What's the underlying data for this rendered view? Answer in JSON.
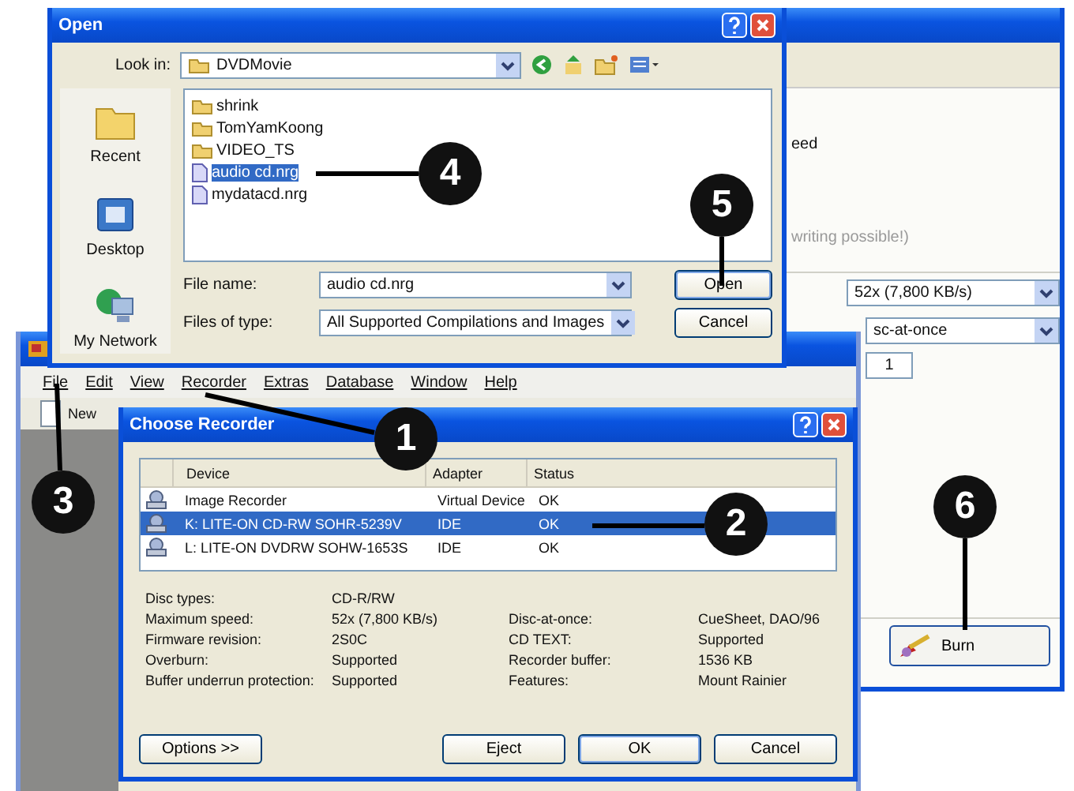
{
  "compilation_window": {
    "texts": [
      "eed",
      "writing possible!)"
    ],
    "speed": "52x (7,800 KB/s)",
    "method": "sc-at-once",
    "copies": "1",
    "burn_button": "Burn"
  },
  "main_window": {
    "menu": [
      "File",
      "Edit",
      "View",
      "Recorder",
      "Extras",
      "Database",
      "Window",
      "Help"
    ],
    "toolbar": [
      "New"
    ]
  },
  "open_dialog": {
    "title": "Open",
    "look_in_label": "Look in:",
    "look_in": "DVDMovie",
    "places": [
      {
        "label": "Recent",
        "kind": "recent"
      },
      {
        "label": "Desktop",
        "kind": "desktop"
      },
      {
        "label": "My Network",
        "kind": "network"
      }
    ],
    "files": [
      {
        "name": "shrink",
        "kind": "folder",
        "selected": false
      },
      {
        "name": "TomYamKoong",
        "kind": "folder",
        "selected": false
      },
      {
        "name": "VIDEO_TS",
        "kind": "folder",
        "selected": false
      },
      {
        "name": "audio cd.nrg",
        "kind": "file",
        "selected": true
      },
      {
        "name": "mydatacd.nrg",
        "kind": "file",
        "selected": false
      }
    ],
    "file_name_label": "File name:",
    "file_name": "audio cd.nrg",
    "file_type_label": "Files of type:",
    "file_type": "All Supported Compilations and Images",
    "buttons": [
      "Open",
      "Cancel"
    ]
  },
  "choose_recorder": {
    "title": "Choose Recorder",
    "columns": [
      "Device",
      "Adapter",
      "Status"
    ],
    "rows": [
      {
        "device": "Image Recorder",
        "adapter": "Virtual Device",
        "status": "OK",
        "selected": false
      },
      {
        "device": "K:  LITE-ON CD-RW SOHR-5239V",
        "adapter": "IDE",
        "status": "OK",
        "selected": true
      },
      {
        "device": "L:  LITE-ON DVDRW SOHW-1653S",
        "adapter": "IDE",
        "status": "OK",
        "selected": false
      }
    ],
    "properties": [
      {
        "label": "Disc types:",
        "value": "CD-R/RW"
      },
      {
        "label": "Maximum speed:",
        "value": "52x (7,800 KB/s)",
        "label2": "Disc-at-once:",
        "value2": "CueSheet, DAO/96"
      },
      {
        "label": "Firmware revision:",
        "value": "2S0C",
        "label2": "CD TEXT:",
        "value2": "Supported"
      },
      {
        "label": "Overburn:",
        "value": "Supported",
        "label2": "Recorder buffer:",
        "value2": "1536 KB"
      },
      {
        "label": "Buffer underrun protection:",
        "value": "Supported",
        "label2": "Features:",
        "value2": "Mount Rainier"
      }
    ],
    "buttons": [
      "Options >>",
      "Eject",
      "OK",
      "Cancel"
    ]
  },
  "callouts": [
    {
      "label": "1"
    },
    {
      "label": "2"
    },
    {
      "label": "3"
    },
    {
      "label": "4"
    },
    {
      "label": "5"
    },
    {
      "label": "6"
    }
  ]
}
